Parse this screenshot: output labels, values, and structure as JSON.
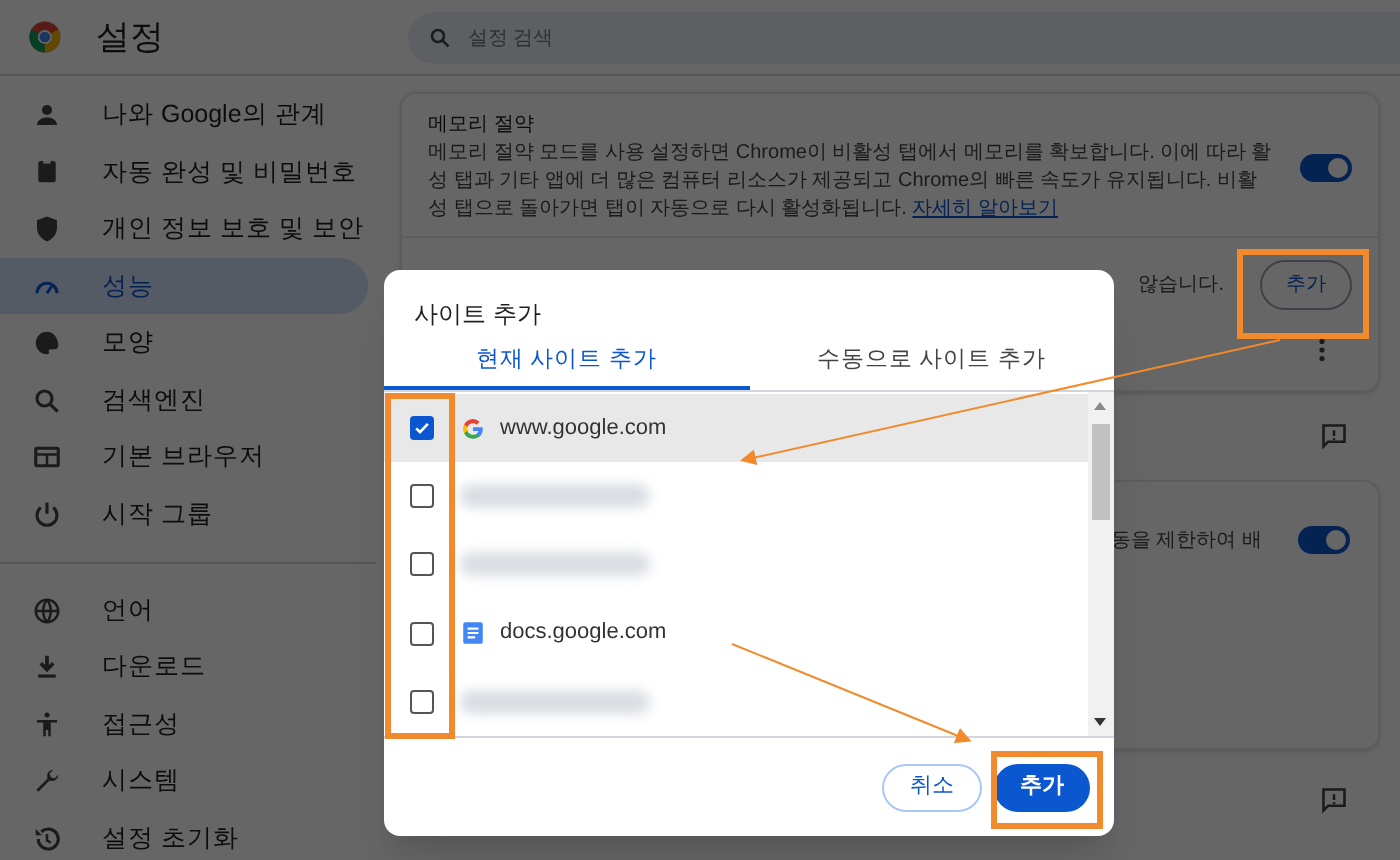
{
  "header": {
    "title": "설정",
    "search": {
      "placeholder": "설정 검색"
    }
  },
  "sidebar": {
    "groups": [
      {
        "items": [
          {
            "label": "나와 Google의 관계",
            "selected": false
          },
          {
            "label": "자동 완성 및 비밀번호",
            "selected": false
          },
          {
            "label": "개인 정보 보호 및 보안",
            "selected": false
          },
          {
            "label": "성능",
            "selected": true
          },
          {
            "label": "모양",
            "selected": false
          },
          {
            "label": "검색엔진",
            "selected": false
          },
          {
            "label": "기본 브라우저",
            "selected": false
          },
          {
            "label": "시작 그룹",
            "selected": false
          }
        ]
      },
      {
        "items": [
          {
            "label": "언어",
            "selected": false
          },
          {
            "label": "다운로드",
            "selected": false
          },
          {
            "label": "접근성",
            "selected": false
          },
          {
            "label": "시스템",
            "selected": false
          },
          {
            "label": "설정 초기화",
            "selected": false
          }
        ]
      }
    ]
  },
  "memory_card": {
    "title": "메모리 절약",
    "description": "메모리 절약 모드를 사용 설정하면 Chrome이 비활성 탭에서 메모리를 확보합니다. 이에 따라 활성 탭과 기타 앱에 더 많은 컴퓨터 리소스가 제공되고 Chrome의 빠른 속도가 유지됩니다. 비활성 탭으로 돌아가면 탭이 자동으로 다시 활성화됩니다. ",
    "link": "자세히 알아보기",
    "on": true,
    "exception_text": "않습니다.",
    "add_button": "추가"
  },
  "energy_card": {
    "text": "동을 제한하여 배",
    "on": true
  },
  "dialog": {
    "title": "사이트 추가",
    "tabs": [
      {
        "label": "현재 사이트 추가",
        "selected": true
      },
      {
        "label": "수동으로 사이트 추가",
        "selected": false
      }
    ],
    "sites": [
      {
        "kind": "google",
        "domain": "www.google.com",
        "checked": true
      },
      {
        "kind": "blurred",
        "checked": false
      },
      {
        "kind": "blurred",
        "checked": false
      },
      {
        "kind": "docs",
        "domain": "docs.google.com",
        "checked": false
      },
      {
        "kind": "blurred",
        "checked": false
      }
    ],
    "buttons": [
      {
        "label": "취소",
        "kind": "secondary"
      },
      {
        "label": "추가",
        "kind": "primary"
      }
    ]
  }
}
